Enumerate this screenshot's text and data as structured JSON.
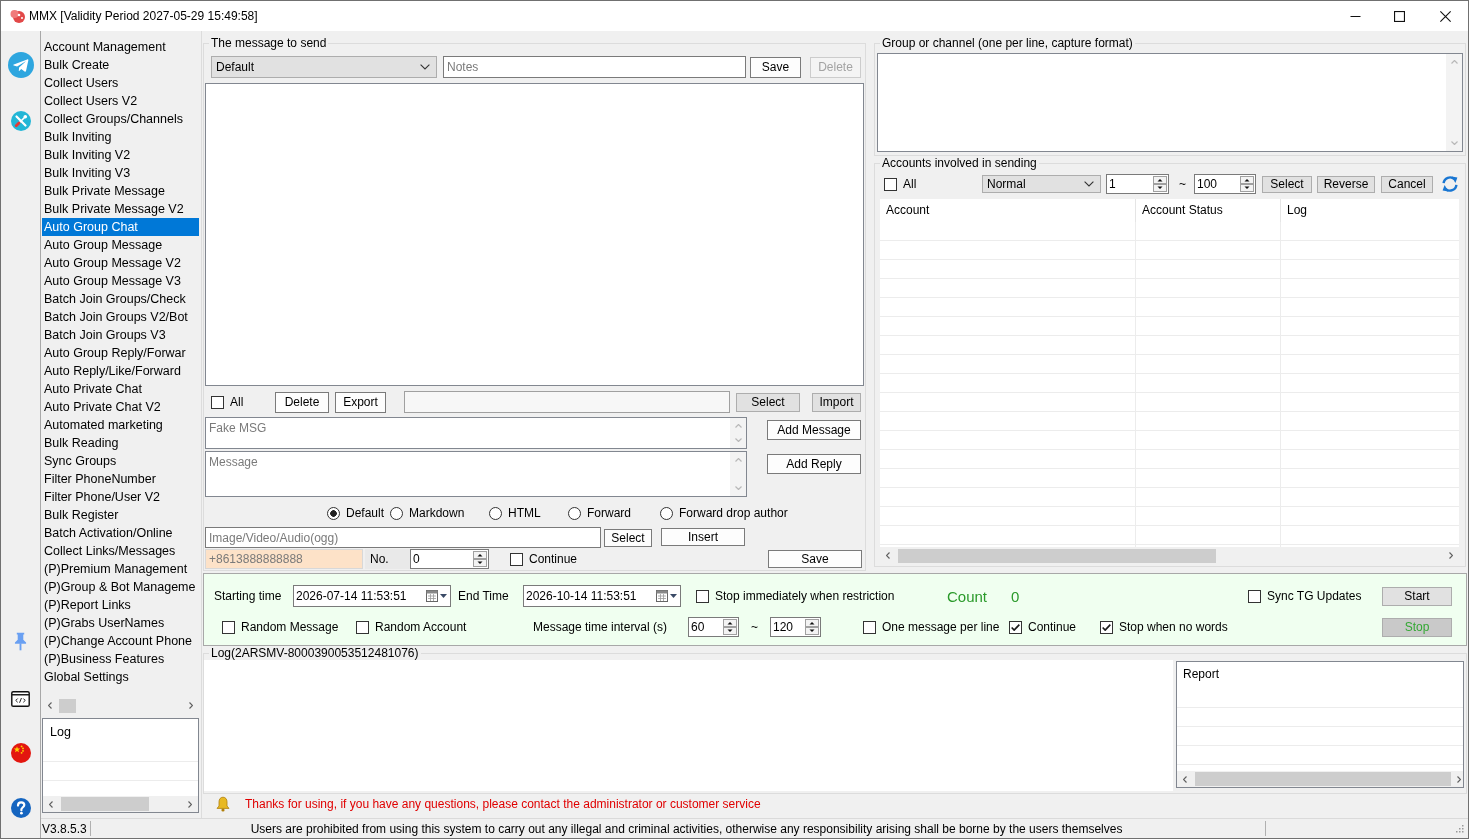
{
  "window": {
    "title": "MMX [Validity Period 2027-05-29 15:49:58]"
  },
  "sidebar": {
    "items": [
      {
        "label": "Account Management",
        "selected": false
      },
      {
        "label": "Bulk Create",
        "selected": false
      },
      {
        "label": "Collect Users",
        "selected": false
      },
      {
        "label": "Collect Users V2",
        "selected": false
      },
      {
        "label": "Collect Groups/Channels",
        "selected": false
      },
      {
        "label": "Bulk Inviting",
        "selected": false
      },
      {
        "label": "Bulk Inviting V2",
        "selected": false
      },
      {
        "label": "Bulk Inviting V3",
        "selected": false
      },
      {
        "label": "Bulk Private Message",
        "selected": false
      },
      {
        "label": "Bulk Private Message V2",
        "selected": false
      },
      {
        "label": "Auto Group Chat",
        "selected": true
      },
      {
        "label": "Auto Group Message",
        "selected": false
      },
      {
        "label": "Auto Group Message V2",
        "selected": false
      },
      {
        "label": "Auto Group Message V3",
        "selected": false
      },
      {
        "label": "Batch Join Groups/Check",
        "selected": false
      },
      {
        "label": "Batch Join Groups V2/Bot",
        "selected": false
      },
      {
        "label": "Batch Join Groups V3",
        "selected": false
      },
      {
        "label": "Auto Group Reply/Forwar",
        "selected": false
      },
      {
        "label": "Auto Reply/Like/Forward",
        "selected": false
      },
      {
        "label": "Auto Private Chat",
        "selected": false
      },
      {
        "label": "Auto Private Chat V2",
        "selected": false
      },
      {
        "label": "Automated marketing",
        "selected": false
      },
      {
        "label": "Bulk Reading",
        "selected": false
      },
      {
        "label": "Sync Groups",
        "selected": false
      },
      {
        "label": "Filter PhoneNumber",
        "selected": false
      },
      {
        "label": "Filter Phone/User V2",
        "selected": false
      },
      {
        "label": "Bulk Register",
        "selected": false
      },
      {
        "label": "Batch Activation/Online",
        "selected": false
      },
      {
        "label": "Collect Links/Messages",
        "selected": false
      },
      {
        "label": "(P)Premium Management",
        "selected": false
      },
      {
        "label": "(P)Group & Bot Manageme",
        "selected": false
      },
      {
        "label": "(P)Report Links",
        "selected": false
      },
      {
        "label": "(P)Grabs UserNames",
        "selected": false
      },
      {
        "label": "(P)Change Account Phone",
        "selected": false
      },
      {
        "label": "(P)Business Features",
        "selected": false
      },
      {
        "label": "Global Settings",
        "selected": false
      }
    ]
  },
  "side_log": {
    "header": "Log"
  },
  "message_panel": {
    "title": "The message to send",
    "template": "Default",
    "notes": {
      "placeholder": "Notes"
    },
    "header_buttons": [
      {
        "label": "Save",
        "disabled": false
      },
      {
        "label": "Delete",
        "disabled": true
      }
    ],
    "select_all": {
      "label": "All",
      "checked": false
    },
    "list_buttons": [
      "Delete",
      "Export"
    ],
    "file_buttons": [
      "Select",
      "Import"
    ],
    "fake_msg": {
      "placeholder": "Fake MSG"
    },
    "message": {
      "placeholder": "Message"
    },
    "add_buttons": [
      "Add Message",
      "Add Reply"
    ],
    "formats": [
      {
        "label": "Default",
        "selected": true
      },
      {
        "label": "Markdown",
        "selected": false
      },
      {
        "label": "HTML",
        "selected": false
      },
      {
        "label": "Forward",
        "selected": false
      },
      {
        "label": "Forward drop author",
        "selected": false
      }
    ],
    "media": {
      "placeholder": "Image/Video/Audio(ogg)"
    },
    "media_buttons": [
      "Select",
      "Insert"
    ],
    "phone": {
      "placeholder": "+8613888888888"
    },
    "number_label": "No.",
    "number_value": "0",
    "continue": {
      "label": "Continue",
      "checked": false
    },
    "save_button": "Save"
  },
  "targets": {
    "title": "Group or channel (one per line, capture format)"
  },
  "accounts": {
    "title": "Accounts involved in sending",
    "select_all": {
      "label": "All",
      "checked": false
    },
    "filter": "Normal",
    "range_from": "1",
    "range_separator": "~",
    "range_to": "100",
    "buttons": [
      "Select",
      "Reverse",
      "Cancel"
    ],
    "table": {
      "columns": [
        "Account",
        "Account Status",
        "Log"
      ]
    }
  },
  "schedule": {
    "start_label": "Starting time",
    "start_value": "2026-07-14 11:53:51",
    "end_label": "End Time",
    "end_value": "2026-10-14 11:53:51",
    "stop_on_restriction": {
      "label": "Stop immediately when restriction",
      "checked": false
    },
    "count_label": "Count",
    "count_value": "0",
    "sync": {
      "label": "Sync TG Updates",
      "checked": false
    },
    "random_options": [
      {
        "label": "Random Message",
        "checked": false
      },
      {
        "label": "Random Account",
        "checked": false
      }
    ],
    "interval_label": "Message time interval (s)",
    "interval_min": "60",
    "interval_separator": "~",
    "interval_max": "120",
    "options": [
      {
        "label": "One message per line",
        "checked": false
      },
      {
        "label": "Continue",
        "checked": true
      },
      {
        "label": "Stop when no words",
        "checked": true
      }
    ],
    "run_buttons": [
      {
        "label": "Start",
        "disabled": false
      },
      {
        "label": "Stop",
        "disabled": true
      }
    ]
  },
  "log": {
    "title": "Log(2ARSMV-8000390053512481076)",
    "report_header": "Report"
  },
  "notice": "Thanks for using, if you have any questions, please contact the administrator or customer service",
  "status_bar": {
    "version": "V3.8.5.3",
    "message": "Users are prohibited from using this system to carry out any illegal and criminal activities, otherwise any responsibility arising shall be borne by the users themselves"
  }
}
